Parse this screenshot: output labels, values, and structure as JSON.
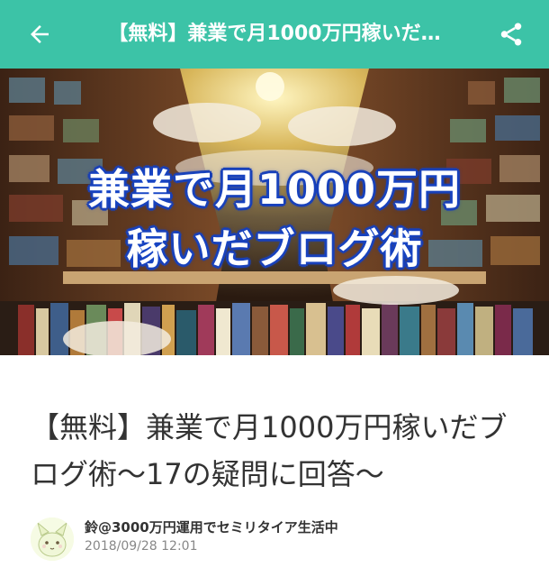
{
  "appbar": {
    "title": "【無料】兼業で月1000万円稼いだ…",
    "back_icon": "arrow-left-icon",
    "share_icon": "share-icon",
    "color": "#3cc3a7"
  },
  "hero": {
    "line1": "兼業で月1000万円",
    "line2": "稼いだブログ術",
    "text_outline_color": "#1e3fae"
  },
  "article": {
    "title": "【無料】兼業で月1000万円稼いだブログ術〜17の疑問に回答〜"
  },
  "author": {
    "name": "鈴@3000万円運用でセミリタイア生活中",
    "date": "2018/09/28 12:01",
    "avatar_icon": "avatar-icon"
  }
}
